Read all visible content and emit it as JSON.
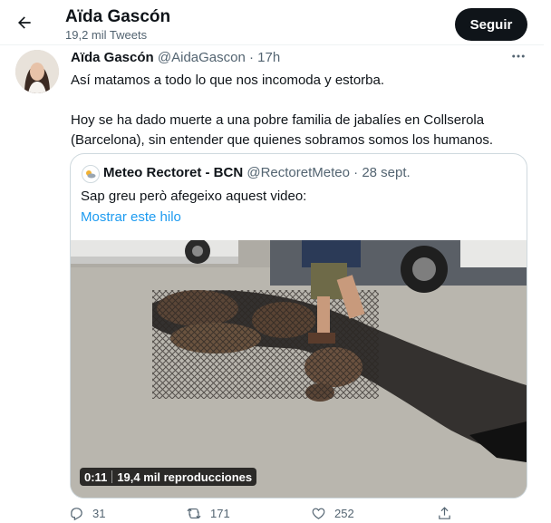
{
  "header": {
    "title": "Aïda Gascón",
    "subtitle": "19,2 mil Tweets",
    "follow_label": "Seguir"
  },
  "tweet": {
    "name": "Aïda Gascón",
    "handle": "@AidaGascon",
    "separator": "·",
    "time": "17h",
    "text_1": "Así matamos a todo lo que nos incomoda y estorba.",
    "text_2": "Hoy se ha dado muerte a una pobre familia de jabalíes en Collserola (Barcelona), sin entender que quienes sobramos somos los humanos."
  },
  "quote": {
    "name": "Meteo Rectoret - BCN",
    "handle": "@RectoretMeteo",
    "separator": "·",
    "time": "28 sept.",
    "text": "Sap greu però afegeixo aquest video:",
    "link": "Mostrar este hilo",
    "video": {
      "duration": "0:11",
      "views": "19,4 mil reproducciones"
    }
  },
  "actions": {
    "replies": "31",
    "retweets": "171",
    "likes": "252"
  },
  "icons": {
    "back": "arrow-left-icon",
    "more": "more-horizontal-icon",
    "reply": "reply-icon",
    "retweet": "retweet-icon",
    "like": "heart-icon",
    "share": "share-icon"
  },
  "colors": {
    "text": "#0f1419",
    "secondary": "#536471",
    "link": "#1d9bf0",
    "border": "#cfd9de",
    "button": "#0f1419"
  }
}
